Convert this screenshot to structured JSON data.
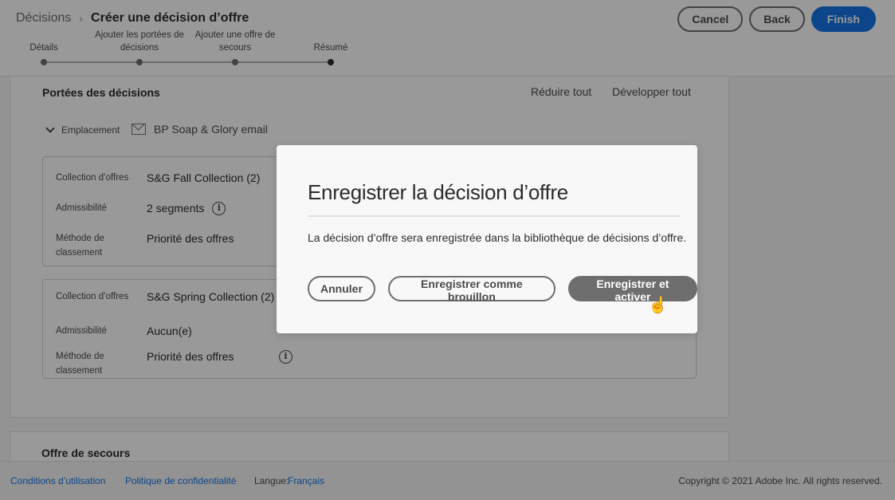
{
  "header": {
    "breadcrumb_root": "Décisions",
    "breadcrumb_sep": "›",
    "breadcrumb_current": "Créer une décision d’offre",
    "cancel_label": "Cancel",
    "back_label": "Back",
    "finish_label": "Finish"
  },
  "stepper": {
    "steps": [
      {
        "line1": "",
        "line2": "Détails"
      },
      {
        "line1": "Ajouter les portées de",
        "line2": "décisions"
      },
      {
        "line1": "Ajouter une offre de",
        "line2": "secours"
      },
      {
        "line1": "",
        "line2": "Résumé"
      }
    ],
    "active_step": 4
  },
  "scopes": {
    "title": "Portées des décisions",
    "collapse_all": "Réduire tout",
    "expand_all": "Développer tout",
    "placement_label": "Emplacement",
    "placement_value": "BP Soap & Glory email",
    "cards": [
      {
        "collection_label": "Collection d’offres",
        "collection_value": "S&G Fall Collection (2)",
        "eligibility_label": "Admissibilité",
        "eligibility_value": "2 segments",
        "ranking_label_1": "Méthode de",
        "ranking_label_2": "classement",
        "ranking_value": "Priorité des offres"
      },
      {
        "collection_label": "Collection d’offres",
        "collection_value": "S&G Spring Collection (2)",
        "eligibility_label": "Admissibilité",
        "eligibility_value": "Aucun(e)",
        "ranking_label_1": "Méthode de",
        "ranking_label_2": "classement",
        "ranking_value": "Priorité des offres"
      }
    ]
  },
  "fallback": {
    "title": "Offre de secours"
  },
  "footer": {
    "terms": "Conditions d’utilisation",
    "privacy": "Politique de confidentialité",
    "language_label": "Langue:",
    "language_value": "Français",
    "copyright": "Copyright © 2021 Adobe Inc. All rights reserved."
  },
  "dialog": {
    "title": "Enregistrer la décision d’offre",
    "body": "La décision d’offre sera enregistrée dans la bibliothèque de décisions d’offre.",
    "cancel_label": "Annuler",
    "draft_label": "Enregistrer comme brouillon",
    "save_activate_label": "Enregistrer et activer"
  },
  "colors": {
    "accent": "#1473e6",
    "overlay": "rgba(0,0,0,0.4)"
  }
}
